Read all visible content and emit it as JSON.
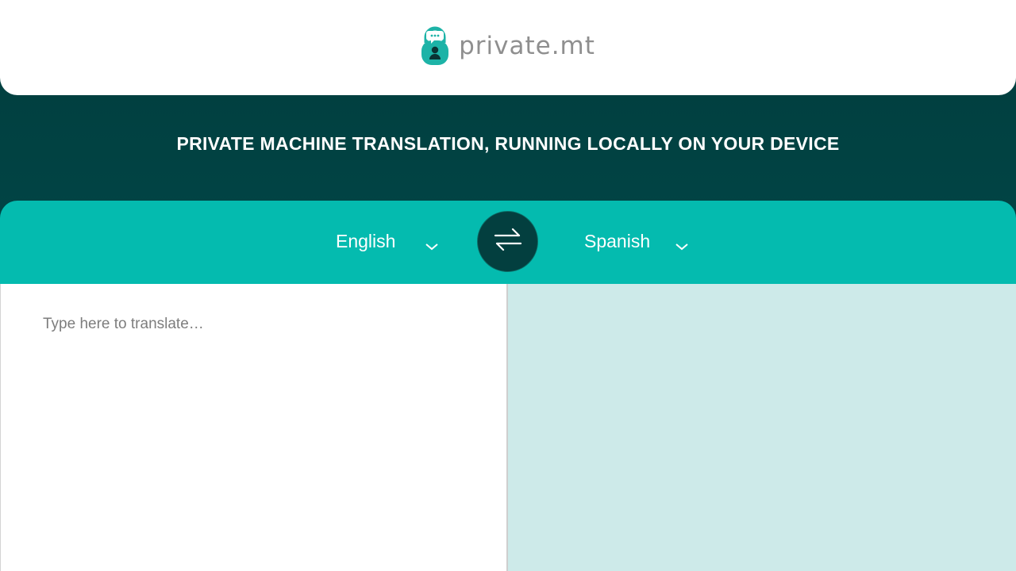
{
  "header": {
    "logo_text": "private.mt",
    "logo_icon": "lock-chat-icon"
  },
  "hero": {
    "tagline": "PRIVATE MACHINE TRANSLATION, RUNNING LOCALLY ON YOUR DEVICE"
  },
  "languages": {
    "source": "English",
    "target": "Spanish",
    "chevron_icon": "chevron-down-icon",
    "swap_icon": "swap-arrows-icon"
  },
  "editor": {
    "source_placeholder": "Type here to translate…",
    "source_value": "",
    "target_value": ""
  },
  "colors": {
    "primary_dark": "#014545",
    "accent_teal": "#04bbaf",
    "swap_button": "#033f3f",
    "output_panel": "#cdeae9",
    "logo_gray": "#8f8f8f"
  }
}
